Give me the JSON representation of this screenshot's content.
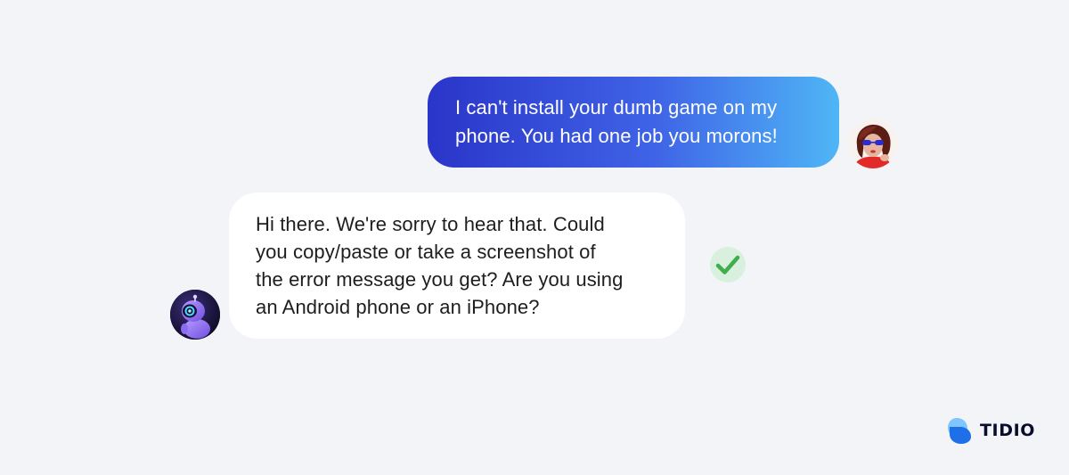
{
  "conversation": {
    "messages": [
      {
        "sender": "user",
        "text": "I can't install your dumb game on my phone. You had one job you morons!",
        "lines": [
          "I can't install your dumb game on my",
          "phone. You had one job you morons!"
        ]
      },
      {
        "sender": "bot",
        "text": "Hi there. We're sorry to hear that. Could you copy/paste or take a screenshot of the error message you get? Are you using an Android phone or an iPhone?",
        "lines": [
          "Hi there. We're sorry to hear that. Could",
          "you copy/paste or take a screenshot of",
          "the error message you get? Are you using",
          "an Android phone or an iPhone?"
        ]
      }
    ],
    "status_icon": "checkmark-icon"
  },
  "brand": {
    "name": "TIDIO",
    "logo_icon": "tidio-logo-icon"
  },
  "colors": {
    "background": "#f3f4f8",
    "user_bubble_start": "#2a35c9",
    "user_bubble_end": "#4fb6f6",
    "bot_bubble": "#ffffff",
    "check_green": "#3fae4c",
    "brand_blue": "#2f8cf3"
  }
}
